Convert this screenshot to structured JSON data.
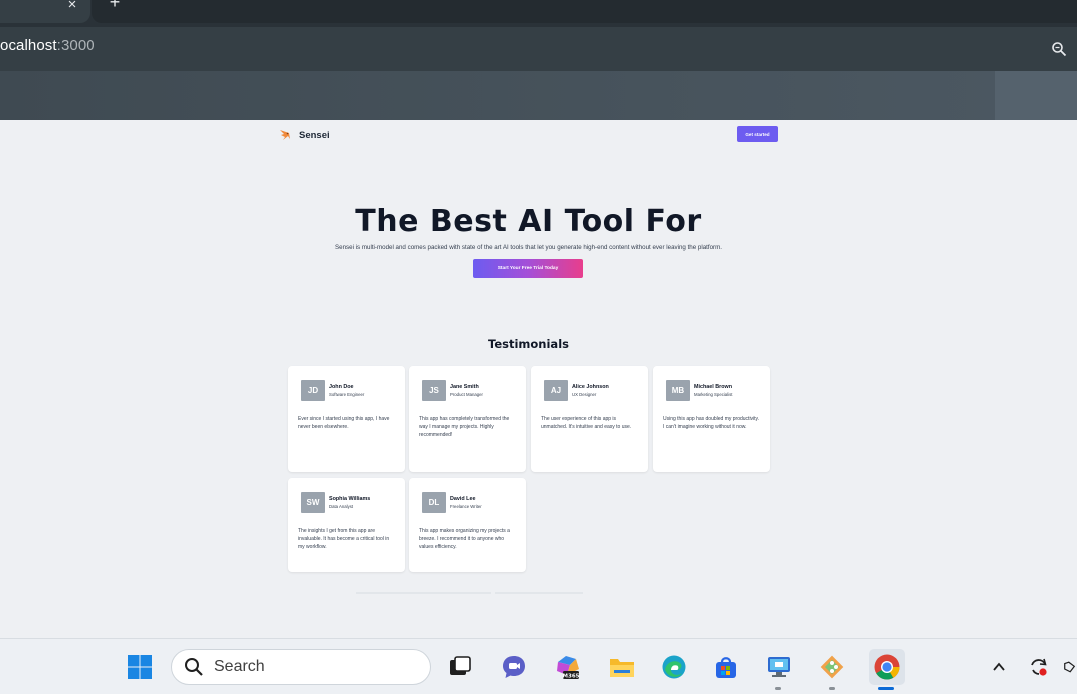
{
  "browser": {
    "tab_close_glyph": "×",
    "new_tab_glyph": "+",
    "url_host": "ocalhost",
    "url_port": ":3000",
    "zoom_icon": "magnifier-icon"
  },
  "site": {
    "brand": "Sensei",
    "logo_icon": "bird-logo-icon",
    "get_started": "Get started",
    "hero_title": "The Best AI Tool For",
    "hero_subtitle": "Sensei is multi-model and comes packed with state of the art AI tools that let you generate high-end content without ever leaving the platform.",
    "cta": "Start Your Free Trial Today",
    "accent_colors": [
      "#6d5cf0",
      "#a44fd8",
      "#e83e8c"
    ],
    "testimonials_title": "Testimonials",
    "testimonials": [
      {
        "initials": "JD",
        "name": "John Doe",
        "role": "Software Engineer",
        "text": "Ever since I started using this app, I have never been elsewhere."
      },
      {
        "initials": "JS",
        "name": "Jane Smith",
        "role": "Product Manager",
        "text": "This app has completely transformed the way I manage my projects. Highly recommended!"
      },
      {
        "initials": "AJ",
        "name": "Alice Johnson",
        "role": "UX Designer",
        "text": "The user experience of this app is unmatched. It's intuitive and easy to use."
      },
      {
        "initials": "MB",
        "name": "Michael Brown",
        "role": "Marketing Specialist",
        "text": "Using this app has doubled my productivity. I can't imagine working without it now."
      },
      {
        "initials": "SW",
        "name": "Sophia Williams",
        "role": "Data Analyst",
        "text": "The insights I get from this app are invaluable. It has become a critical tool in my workflow."
      },
      {
        "initials": "DL",
        "name": "David Lee",
        "role": "Freelance Writer",
        "text": "This app makes organizing my projects a breeze. I recommend it to anyone who values efficiency."
      }
    ]
  },
  "taskbar": {
    "search_label": "Search",
    "icons": [
      "windows-start-icon",
      "search-icon",
      "task-view-icon",
      "chat-icon",
      "m365-icon",
      "file-explorer-icon",
      "edge-icon",
      "store-icon",
      "remote-desktop-icon",
      "git-icon",
      "chrome-icon"
    ],
    "m365_badge": "M365",
    "tray": [
      "chevron-up-icon",
      "sync-icon",
      "app-tray-icon"
    ]
  }
}
